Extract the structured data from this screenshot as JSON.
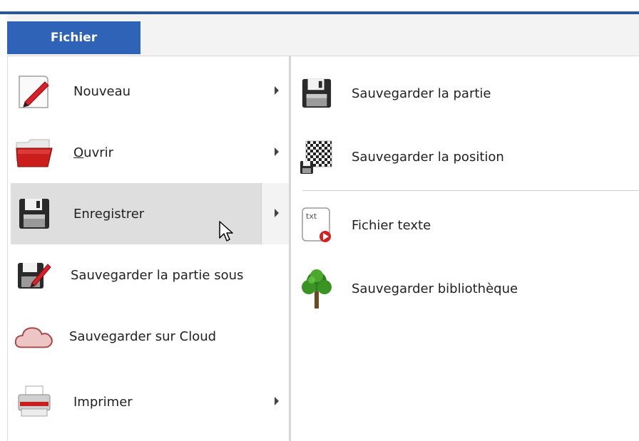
{
  "ribbon": {
    "file_tab": "Fichier"
  },
  "left_menu": {
    "items": [
      {
        "label": "Nouveau",
        "icon": "new-document-icon",
        "has_submenu": true
      },
      {
        "label_prefix": "",
        "label_accel": "O",
        "label_rest": "uvrir",
        "icon": "open-folder-icon",
        "has_submenu": true
      },
      {
        "label": "Enregistrer",
        "icon": "save-floppy-icon",
        "has_submenu": true,
        "active": true
      },
      {
        "label": "Sauvegarder la partie sous",
        "icon": "save-as-icon",
        "has_submenu": false
      },
      {
        "label": "Sauvegarder sur Cloud",
        "icon": "cloud-icon",
        "has_submenu": false
      },
      {
        "label": "Imprimer",
        "icon": "printer-icon",
        "has_submenu": true
      }
    ]
  },
  "submenu": {
    "items": [
      {
        "label": "Sauvegarder la partie",
        "icon": "save-floppy-icon"
      },
      {
        "label": "Sauvegarder la position",
        "icon": "save-position-icon"
      },
      {
        "label": "Fichier texte",
        "icon": "text-file-icon",
        "icon_text": "txt"
      },
      {
        "label": "Sauvegarder bibliothèque",
        "icon": "tree-library-icon"
      }
    ]
  },
  "colors": {
    "accent": "#2f63b8",
    "top_bar": "#2b5797",
    "active_item": "#dedede"
  }
}
